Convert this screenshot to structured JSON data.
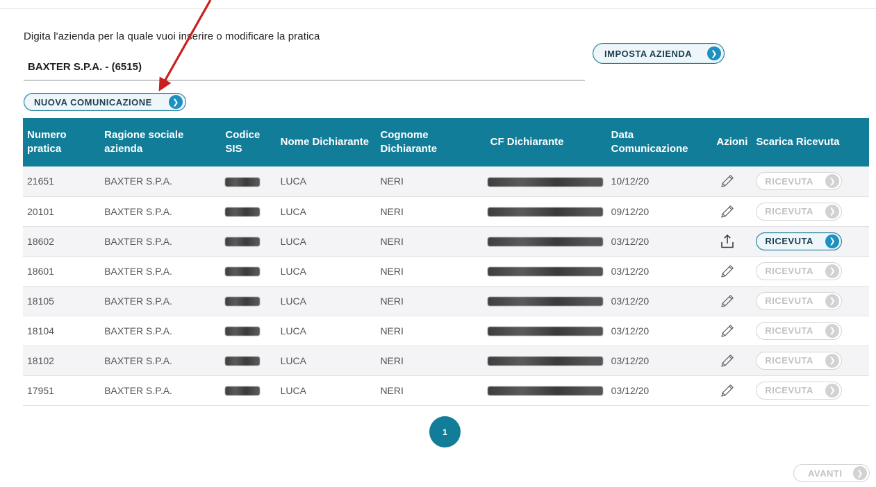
{
  "form": {
    "prompt": "Digita l'azienda per la quale vuoi inserire o modificare la pratica",
    "company_value": "BAXTER S.P.A. - (6515)",
    "set_company_label": "IMPOSTA AZIENDA",
    "new_comm_label": "NUOVA COMUNICAZIONE"
  },
  "table": {
    "headers": {
      "numero": "Numero pratica",
      "ragione": "Ragione sociale azienda",
      "sis": "Codice SIS",
      "nome": "Nome Dichiarante",
      "cognome": "Cognome Dichiarante",
      "cf": "CF Dichiarante",
      "data": "Data Comunicazione",
      "azioni": "Azioni",
      "scarica": "Scarica Ricevuta"
    },
    "rows": [
      {
        "numero": "21651",
        "ragione": "BAXTER S.P.A.",
        "nome": "LUCA",
        "cognome": "NERI",
        "data": "10/12/20",
        "action_icon": "pencil-icon",
        "ricevuta": "RICEVUTA",
        "ricevuta_enabled": false
      },
      {
        "numero": "20101",
        "ragione": "BAXTER S.P.A.",
        "nome": "LUCA",
        "cognome": "NERI",
        "data": "09/12/20",
        "action_icon": "pencil-icon",
        "ricevuta": "RICEVUTA",
        "ricevuta_enabled": false
      },
      {
        "numero": "18602",
        "ragione": "BAXTER S.P.A.",
        "nome": "LUCA",
        "cognome": "NERI",
        "data": "03/12/20",
        "action_icon": "upload-icon",
        "ricevuta": "RICEVUTA",
        "ricevuta_enabled": true
      },
      {
        "numero": "18601",
        "ragione": "BAXTER S.P.A.",
        "nome": "LUCA",
        "cognome": "NERI",
        "data": "03/12/20",
        "action_icon": "pencil-icon",
        "ricevuta": "RICEVUTA",
        "ricevuta_enabled": false
      },
      {
        "numero": "18105",
        "ragione": "BAXTER S.P.A.",
        "nome": "LUCA",
        "cognome": "NERI",
        "data": "03/12/20",
        "action_icon": "pencil-icon",
        "ricevuta": "RICEVUTA",
        "ricevuta_enabled": false
      },
      {
        "numero": "18104",
        "ragione": "BAXTER S.P.A.",
        "nome": "LUCA",
        "cognome": "NERI",
        "data": "03/12/20",
        "action_icon": "pencil-icon",
        "ricevuta": "RICEVUTA",
        "ricevuta_enabled": false
      },
      {
        "numero": "18102",
        "ragione": "BAXTER S.P.A.",
        "nome": "LUCA",
        "cognome": "NERI",
        "data": "03/12/20",
        "action_icon": "pencil-icon",
        "ricevuta": "RICEVUTA",
        "ricevuta_enabled": false
      },
      {
        "numero": "17951",
        "ragione": "BAXTER S.P.A.",
        "nome": "LUCA",
        "cognome": "NERI",
        "data": "03/12/20",
        "action_icon": "pencil-icon",
        "ricevuta": "RICEVUTA",
        "ricevuta_enabled": false
      }
    ]
  },
  "pagination": {
    "current_page": "1"
  },
  "footer": {
    "next_label": "AVANTI"
  },
  "colors": {
    "header_bg": "#127d99",
    "accent": "#1d8fc0",
    "annotation_arrow": "#c8201c"
  }
}
